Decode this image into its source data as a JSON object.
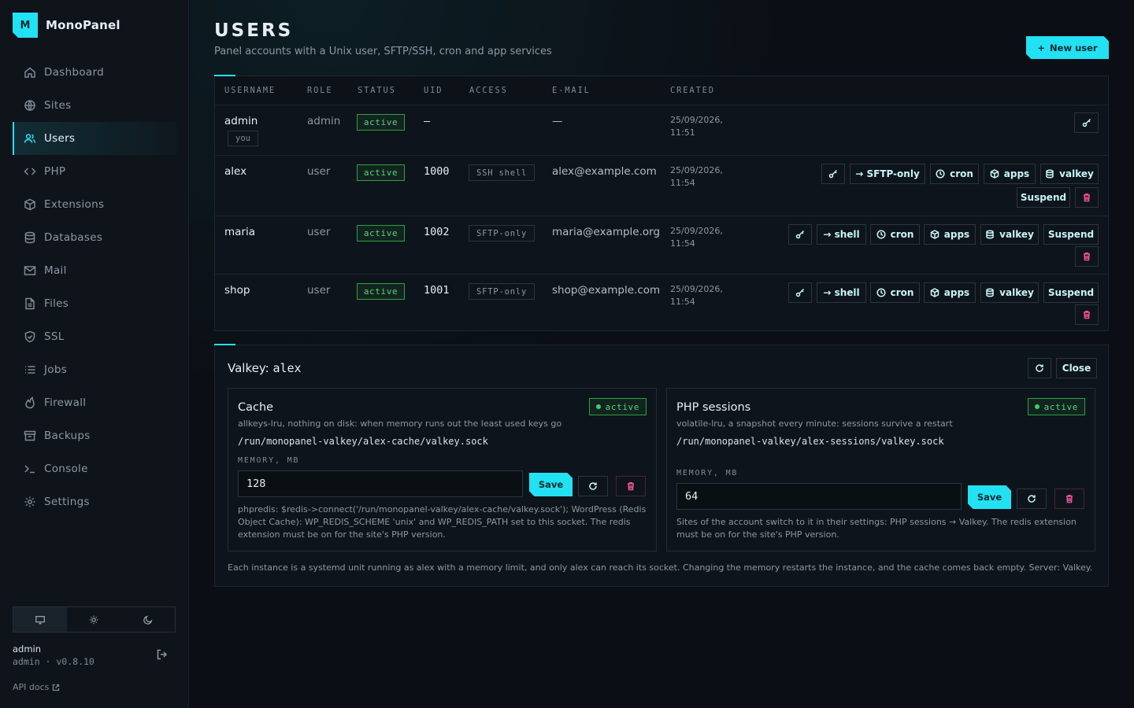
{
  "app": {
    "name": "MonoPanel",
    "logo_letter": "M"
  },
  "sidebar": {
    "items": [
      {
        "label": "Dashboard",
        "icon": "home-icon"
      },
      {
        "label": "Sites",
        "icon": "globe-icon"
      },
      {
        "label": "Users",
        "icon": "users-icon",
        "active": true
      },
      {
        "label": "PHP",
        "icon": "code-icon"
      },
      {
        "label": "Extensions",
        "icon": "box-icon"
      },
      {
        "label": "Databases",
        "icon": "database-icon"
      },
      {
        "label": "Mail",
        "icon": "mail-icon"
      },
      {
        "label": "Files",
        "icon": "file-icon"
      },
      {
        "label": "SSL",
        "icon": "shield-icon"
      },
      {
        "label": "Jobs",
        "icon": "list-icon"
      },
      {
        "label": "Firewall",
        "icon": "flame-icon"
      },
      {
        "label": "Backups",
        "icon": "archive-icon"
      },
      {
        "label": "Console",
        "icon": "terminal-icon"
      },
      {
        "label": "Settings",
        "icon": "gear-icon"
      }
    ],
    "theme_options": [
      "monitor-icon",
      "sun-icon",
      "moon-icon"
    ],
    "user": {
      "name": "admin",
      "meta": "admin · v0.8.10"
    },
    "api_docs": "API docs"
  },
  "header": {
    "title": "USERS",
    "subtitle": "Panel accounts with a Unix user, SFTP/SSH, cron and app services",
    "new_user": "New user"
  },
  "table": {
    "columns": [
      "USERNAME",
      "ROLE",
      "STATUS",
      "UID",
      "ACCESS",
      "E-MAIL",
      "CREATED"
    ],
    "rows": [
      {
        "username": "admin",
        "you": "you",
        "role": "admin",
        "status": "active",
        "uid": "—",
        "access": "",
        "email": "—",
        "created_date": "25/09/2026,",
        "created_time": "11:51"
      },
      {
        "username": "alex",
        "role": "user",
        "status": "active",
        "uid": "1000",
        "access": "SSH shell",
        "email": "alex@example.com",
        "created_date": "25/09/2026,",
        "created_time": "11:54",
        "shell_action": "→ SFTP-only"
      },
      {
        "username": "maria",
        "role": "user",
        "status": "active",
        "uid": "1002",
        "access": "SFTP-only",
        "email": "maria@example.org",
        "created_date": "25/09/2026,",
        "created_time": "11:54",
        "shell_action": "→ shell"
      },
      {
        "username": "shop",
        "role": "user",
        "status": "active",
        "uid": "1001",
        "access": "SFTP-only",
        "email": "shop@example.com",
        "created_date": "25/09/2026,",
        "created_time": "11:54",
        "shell_action": "→ shell"
      }
    ],
    "actions": {
      "cron": "cron",
      "apps": "apps",
      "valkey": "valkey",
      "suspend": "Suspend"
    }
  },
  "valkey": {
    "title_prefix": "Valkey: ",
    "title_user": "alex",
    "close": "Close",
    "cache": {
      "title": "Cache",
      "status": "active",
      "desc": "allkeys-lru, nothing on disk: when memory runs out the least used keys go",
      "path": "/run/monopanel-valkey/alex-cache/valkey.sock",
      "mem_label": "MEMORY, MB",
      "mem_value": "128",
      "save": "Save",
      "note": "phpredis: $redis->connect('/run/monopanel-valkey/alex-cache/valkey.sock'); WordPress (Redis Object Cache): WP_REDIS_SCHEME 'unix' and WP_REDIS_PATH set to this socket. The redis extension must be on for the site's PHP version."
    },
    "sessions": {
      "title": "PHP sessions",
      "status": "active",
      "desc": "volatile-lru, a snapshot every minute: sessions survive a restart",
      "path": "/run/monopanel-valkey/alex-sessions/valkey.sock",
      "mem_label": "MEMORY, MB",
      "mem_value": "64",
      "save": "Save",
      "note": "Sites of the account switch to it in their settings: PHP sessions → Valkey. The redis extension must be on for the site's PHP version."
    },
    "footer": "Each instance is a systemd unit running as alex with a memory limit, and only alex can reach its socket. Changing the memory restarts the instance, and the cache comes back empty. Server: Valkey."
  },
  "colors": {
    "accent": "#22e1f2",
    "active_green": "#5bd27a",
    "danger": "#f0509a"
  }
}
